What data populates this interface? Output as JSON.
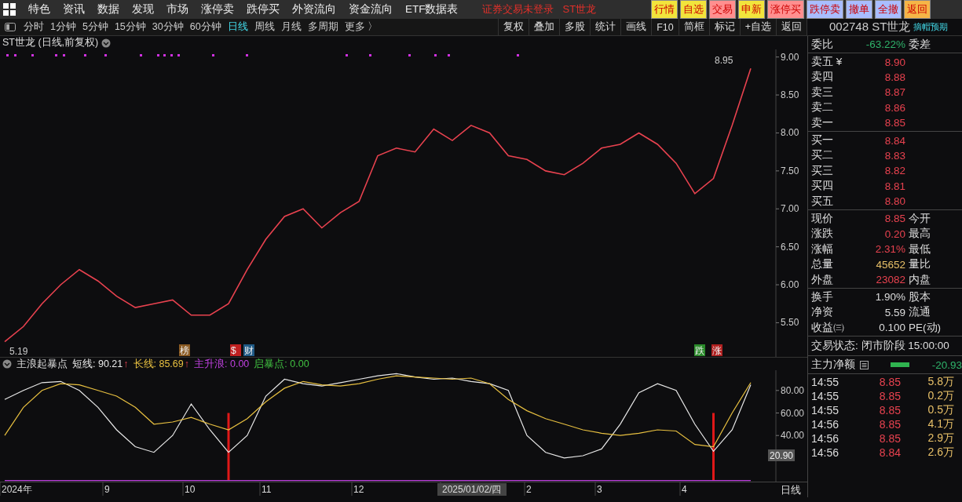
{
  "top_menu": {
    "items": [
      "特色",
      "资讯",
      "数据",
      "发现",
      "市场",
      "涨停卖",
      "跌停买",
      "外资流向",
      "资金流向",
      "ETF数据表"
    ],
    "notice": "证券交易未登录",
    "stock": "ST世龙",
    "buttons": [
      {
        "label": "行情",
        "color": "#f2e43c"
      },
      {
        "label": "自选",
        "color": "#f2e43c"
      },
      {
        "label": "交易",
        "color": "#ff8f8f"
      },
      {
        "label": "申新",
        "color": "#f2e43c"
      },
      {
        "label": "涨停买",
        "color": "#ff8f8f"
      },
      {
        "label": "跌停卖",
        "color": "#a9bdff"
      },
      {
        "label": "撤单",
        "color": "#a9bdff"
      },
      {
        "label": "全撤",
        "color": "#a9bdff"
      },
      {
        "label": "返回",
        "color": "#f5b547"
      }
    ]
  },
  "toolbar": {
    "periods": [
      {
        "label": "分时",
        "selected": false
      },
      {
        "label": "1分钟",
        "selected": false
      },
      {
        "label": "5分钟",
        "selected": false
      },
      {
        "label": "15分钟",
        "selected": false
      },
      {
        "label": "30分钟",
        "selected": false
      },
      {
        "label": "60分钟",
        "selected": false
      },
      {
        "label": "日线",
        "selected": true
      },
      {
        "label": "周线",
        "selected": false
      },
      {
        "label": "月线",
        "selected": false
      },
      {
        "label": "多周期",
        "selected": false
      },
      {
        "label": "更多 〉",
        "selected": false
      }
    ],
    "tools": [
      "复权",
      "叠加",
      "多股",
      "统计",
      "画线",
      "F10",
      "简框",
      "标记",
      "+自选",
      "返回"
    ]
  },
  "price_chart": {
    "title": "ST世龙 (日线,前复权)",
    "chart_data": {
      "type": "line",
      "series": [
        {
          "color": "#e8424f",
          "values": [
            5.25,
            5.45,
            5.75,
            6.0,
            6.2,
            6.05,
            5.85,
            5.7,
            5.75,
            5.8,
            5.6,
            5.6,
            5.75,
            6.2,
            6.6,
            6.9,
            7.0,
            6.75,
            6.95,
            7.1,
            7.7,
            7.8,
            7.75,
            8.05,
            7.9,
            8.1,
            8.0,
            7.7,
            7.65,
            7.5,
            7.45,
            7.6,
            7.8,
            7.85,
            8.0,
            7.85,
            7.6,
            7.2,
            7.4,
            8.1,
            8.85
          ]
        }
      ],
      "ylim": [
        5.05,
        9.1
      ],
      "yticks": [
        {
          "value": 5.5,
          "label": "5.50"
        },
        {
          "value": 6.0,
          "label": "6.00"
        },
        {
          "value": 6.5,
          "label": "6.50"
        },
        {
          "value": 7.0,
          "label": "7.00"
        },
        {
          "value": 7.5,
          "label": "7.50"
        },
        {
          "value": 8.0,
          "label": "8.00"
        },
        {
          "value": 8.5,
          "label": "8.50"
        },
        {
          "value": 9.0,
          "label": "9.00"
        }
      ],
      "annotations": [
        "8.95",
        "5.19"
      ]
    },
    "events": [
      {
        "label": "榜",
        "color": "#8a5a22"
      },
      {
        "label": "$",
        "color": "#c02020"
      },
      {
        "label": "财",
        "color": "#1f5a86"
      },
      {
        "label": "跌",
        "color": "#2a8a2a"
      },
      {
        "label": "涨",
        "color": "#b02020"
      }
    ]
  },
  "indicator": {
    "name": "主浪起暴点",
    "legend": [
      {
        "separator": ":",
        "value": "90.21",
        "arrow": "↑"
      },
      {
        "separator": ":",
        "value": "85.69",
        "arrow": "↑"
      },
      {
        "separator": ":",
        "value": "0.00"
      },
      {
        "label": "启暴点",
        "separator": ":",
        "value": "0.00",
        "color": "#40c040"
      }
    ],
    "chart_data": {
      "type": "line",
      "series": [
        {
          "name": "短线",
          "color": "#e8e8e8",
          "values": [
            72,
            80,
            87,
            88,
            80,
            65,
            45,
            30,
            25,
            40,
            68,
            45,
            25,
            40,
            75,
            90,
            86,
            84,
            87,
            90,
            93,
            95,
            92,
            90,
            91,
            88,
            86,
            80,
            40,
            25,
            20,
            22,
            28,
            50,
            78,
            86,
            80,
            50,
            26,
            45,
            85
          ]
        },
        {
          "name": "长线",
          "color": "#e8c040",
          "values": [
            40,
            65,
            80,
            86,
            85,
            80,
            75,
            65,
            50,
            52,
            56,
            50,
            45,
            55,
            70,
            82,
            88,
            85,
            84,
            86,
            90,
            93,
            92,
            91,
            90,
            91,
            86,
            72,
            62,
            55,
            50,
            45,
            42,
            40,
            42,
            45,
            44,
            32,
            30,
            60,
            87
          ]
        },
        {
          "name": "主升浪",
          "color": "#c040e0",
          "values": [
            0,
            0,
            0,
            0,
            0,
            0,
            0,
            0,
            0,
            0,
            0,
            0,
            0,
            0,
            0,
            0,
            0,
            0,
            0,
            0,
            0,
            0,
            0,
            0,
            0,
            0,
            0,
            0,
            0,
            0,
            0,
            0,
            0,
            0,
            0,
            0,
            0,
            0,
            0,
            0,
            0
          ]
        },
        {
          "type": "bar",
          "color": "#e01818",
          "values": [
            null,
            null,
            null,
            null,
            null,
            null,
            null,
            null,
            null,
            null,
            null,
            null,
            60,
            null,
            null,
            null,
            null,
            null,
            null,
            null,
            null,
            null,
            null,
            null,
            null,
            null,
            null,
            null,
            null,
            null,
            null,
            null,
            null,
            null,
            null,
            null,
            null,
            null,
            60,
            null,
            null
          ]
        }
      ],
      "ylim": [
        -1,
        98
      ],
      "yticks": [
        {
          "value": 40,
          "label": "40.00"
        },
        {
          "value": 60,
          "label": "60.00"
        },
        {
          "value": 80,
          "label": "80.00"
        }
      ]
    },
    "current_value": "20.90",
    "x_axis": [
      {
        "label": "2024年",
        "highlighted": false
      },
      {
        "label": "9",
        "highlighted": false
      },
      {
        "label": "10",
        "highlighted": false
      },
      {
        "label": "11",
        "highlighted": false
      },
      {
        "label": "12",
        "highlighted": false
      },
      {
        "label": "2025/01/02/四",
        "highlighted": true
      },
      {
        "label": "2",
        "highlighted": false
      },
      {
        "label": "3",
        "highlighted": false
      },
      {
        "label": "4",
        "highlighted": false
      }
    ],
    "period_label": "日线"
  },
  "quote_panel": {
    "code": "002748",
    "name": "ST世龙",
    "tag": "摘帽预期",
    "ratio": {
      "label": "委比",
      "value": "-63.22%",
      "label2": "委差",
      "color": "#2fb36b"
    },
    "asks": [
      {
        "label": "卖五 ¥",
        "price": "8.90"
      },
      {
        "label": "卖四",
        "price": "8.88"
      },
      {
        "label": "卖三",
        "price": "8.87"
      },
      {
        "label": "卖二",
        "price": "8.86"
      },
      {
        "label": "卖一",
        "price": "8.85"
      }
    ],
    "bids": [
      {
        "label": "买一",
        "price": "8.84"
      },
      {
        "label": "买二",
        "price": "8.83"
      },
      {
        "label": "买三",
        "price": "8.82"
      },
      {
        "label": "买四",
        "price": "8.81"
      },
      {
        "label": "买五",
        "price": "8.80"
      }
    ],
    "stats": [
      {
        "label": "现价",
        "value": "8.85",
        "label2": "今开",
        "color": "#e8424f"
      },
      {
        "label": "涨跌",
        "value": "0.20",
        "label2": "最高",
        "color": "#e8424f"
      },
      {
        "label": "涨幅",
        "value": "2.31%",
        "label2": "最低",
        "color": "#e8424f"
      },
      {
        "label": "总量",
        "value": "45652",
        "label2": "量比",
        "color": "#e8c068"
      },
      {
        "label": "外盘",
        "value": "23082",
        "label2": "内盘",
        "color": "#e8424f"
      }
    ],
    "fundamentals": [
      {
        "label": "换手",
        "value": "1.90%",
        "label2": "股本",
        "color": "#dcdcdc"
      },
      {
        "label": "净资",
        "value": "5.59",
        "label2": "流通",
        "color": "#dcdcdc"
      },
      {
        "label": "收益㈢",
        "value": "0.100",
        "label2": "PE(动)",
        "color": "#dcdcdc"
      }
    ],
    "status": "交易状态: 闭市阶段 15:00:00",
    "net_flow": {
      "label": "主力净额",
      "value": "-20.93"
    },
    "trades": [
      {
        "time": "14:55",
        "price": "8.85",
        "volume": "5.8万"
      },
      {
        "time": "14:55",
        "price": "8.85",
        "volume": "0.2万"
      },
      {
        "time": "14:55",
        "price": "8.85",
        "volume": "0.5万"
      },
      {
        "time": "14:56",
        "price": "8.85",
        "volume": "4.1万"
      },
      {
        "time": "14:56",
        "price": "8.85",
        "volume": "2.9万"
      },
      {
        "time": "14:56",
        "price": "8.84",
        "volume": "2.6万"
      }
    ]
  }
}
